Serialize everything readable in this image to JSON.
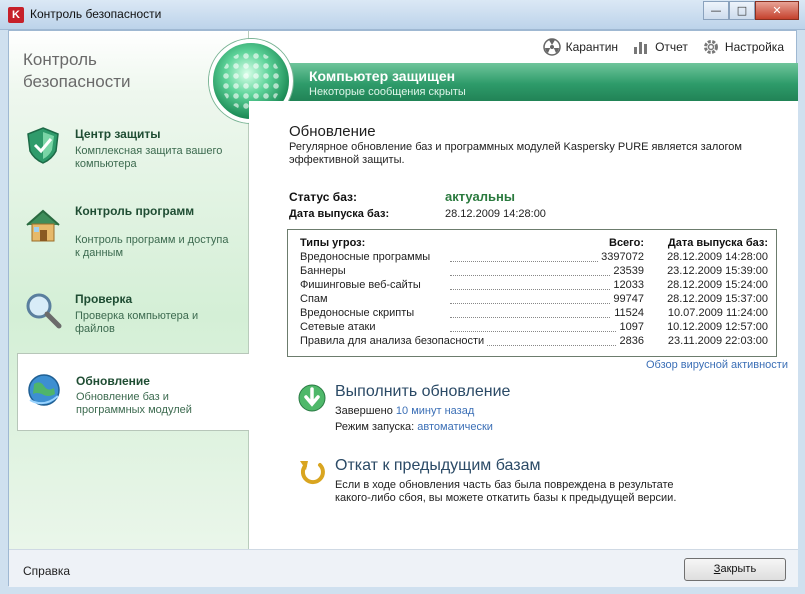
{
  "window": {
    "title": "Контроль безопасности",
    "icon_letter": "K",
    "controls": {
      "minimize": "—",
      "maximize": "□",
      "close": "✕"
    }
  },
  "left": {
    "title": "Контроль безопасности",
    "items": [
      {
        "title": "Центр защиты",
        "desc": "Комплексная защита вашего компьютера",
        "icon": "shield-icon"
      },
      {
        "title": "Контроль программ",
        "desc": "Контроль программ и доступа к данным",
        "icon": "house-icon"
      },
      {
        "title": "Проверка",
        "desc": "Проверка компьютера и файлов",
        "icon": "magnifier-icon"
      },
      {
        "title": "Обновление",
        "desc": "Обновление баз и программных модулей",
        "icon": "globe-icon"
      }
    ]
  },
  "toolbar": {
    "quarantine": "Карантин",
    "report": "Отчет",
    "settings": "Настройка"
  },
  "status": {
    "title": "Компьютер защищен",
    "subtitle": "Некоторые сообщения скрыты"
  },
  "update": {
    "title": "Обновление",
    "desc": "Регулярное обновление баз и программных модулей Kaspersky PURE является залогом эффективной защиты.",
    "db_status_label": "Статус баз:",
    "db_status_value": "актуальны",
    "db_date_label": "Дата выпуска баз:",
    "db_date_value": "28.12.2009 14:28:00"
  },
  "threats": {
    "headers": {
      "type": "Типы угроз:",
      "total": "Всего:",
      "date": "Дата выпуска баз:"
    },
    "rows": [
      {
        "name": "Вредоносные программы",
        "total": "3397072",
        "date": "28.12.2009 14:28:00"
      },
      {
        "name": "Баннеры",
        "total": "23539",
        "date": "23.12.2009 15:39:00"
      },
      {
        "name": "Фишинговые веб-сайты",
        "total": "12033",
        "date": "28.12.2009 15:24:00"
      },
      {
        "name": "Спам",
        "total": "99747",
        "date": "28.12.2009 15:37:00"
      },
      {
        "name": "Вредоносные скрипты",
        "total": "11524",
        "date": "10.07.2009 11:24:00"
      },
      {
        "name": "Сетевые атаки",
        "total": "1097",
        "date": "10.12.2009 12:57:00"
      },
      {
        "name": "Правила для анализа безопасности",
        "total": "2836",
        "date": "23.11.2009 22:03:00"
      }
    ]
  },
  "virus_link": "Обзор вирусной активности",
  "run_update": {
    "title": "Выполнить обновление",
    "finished_label": "Завершено",
    "finished_value": "10 минут назад",
    "mode_label": "Режим запуска:",
    "mode_value": "автоматически"
  },
  "rollback": {
    "title": "Откат к предыдущим базам",
    "desc": "Если в ходе обновления часть баз была повреждена в результате какого-либо сбоя, вы можете откатить базы к предыдущей версии."
  },
  "footer": {
    "help": "Справка",
    "close_first": "З",
    "close_rest": "акрыть"
  }
}
